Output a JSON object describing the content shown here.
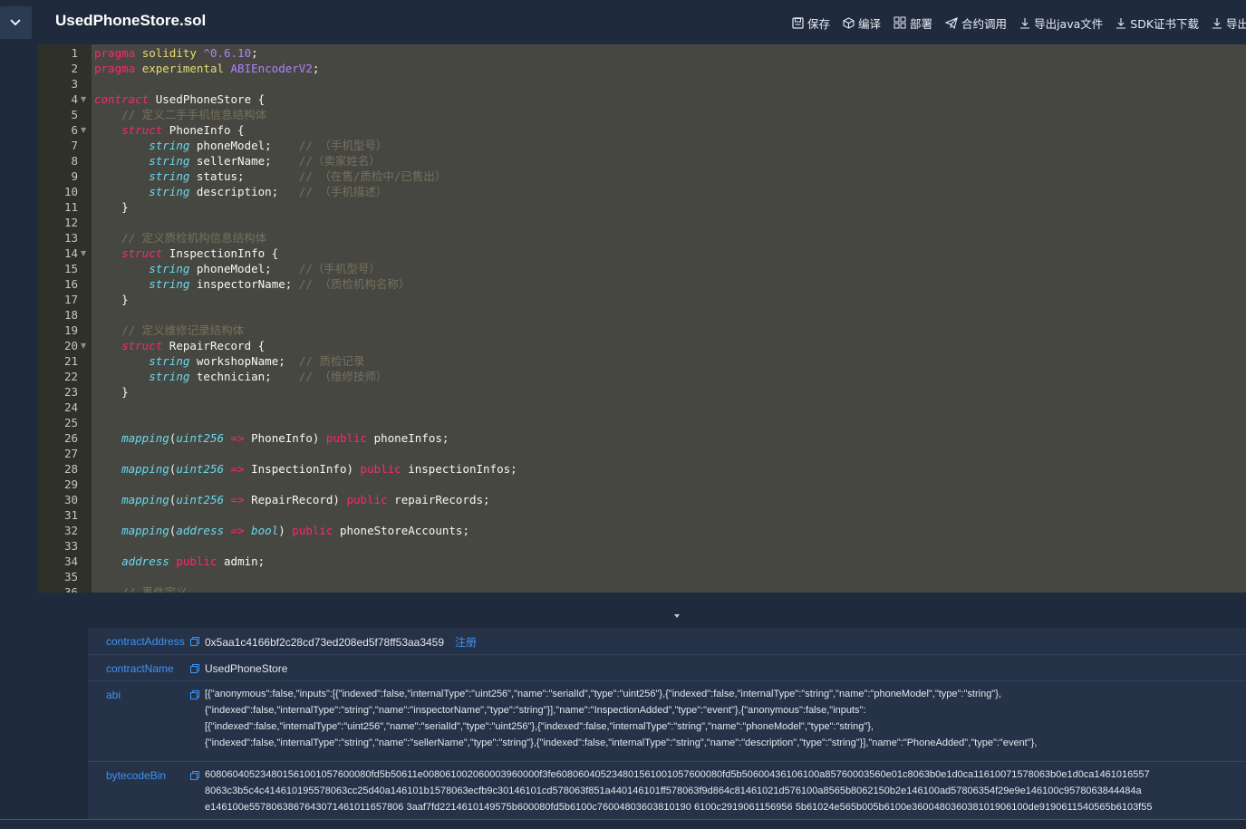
{
  "header": {
    "file_title": "UsedPhoneStore.sol",
    "toolbar": [
      "保存",
      "编译",
      "部署",
      "合约调用",
      "导出java文件",
      "SDK证书下载",
      "导出"
    ]
  },
  "editor": {
    "lines": [
      [
        [
          "kw",
          "pragma "
        ],
        [
          "ac",
          "solidity "
        ],
        [
          "ver",
          "^0.6.10"
        ],
        [
          "pl",
          ";"
        ]
      ],
      [
        [
          "kw",
          "pragma "
        ],
        [
          "ac",
          "experimental "
        ],
        [
          "ver",
          "ABIEncoderV2"
        ],
        [
          "pl",
          ";"
        ]
      ],
      [],
      [
        [
          "kwi",
          "contract "
        ],
        [
          "pl",
          "UsedPhoneStore {"
        ]
      ],
      [
        [
          "pl",
          "    "
        ],
        [
          "cm",
          "// 定义二手手机信息结构体"
        ]
      ],
      [
        [
          "pl",
          "    "
        ],
        [
          "kwi",
          "struct "
        ],
        [
          "pl",
          "PhoneInfo {"
        ]
      ],
      [
        [
          "pl",
          "        "
        ],
        [
          "ty",
          "string "
        ],
        [
          "pl",
          "phoneModel;    "
        ],
        [
          "cm",
          "// （手机型号）"
        ]
      ],
      [
        [
          "pl",
          "        "
        ],
        [
          "ty",
          "string "
        ],
        [
          "pl",
          "sellerName;    "
        ],
        [
          "cm",
          "//（卖家姓名）"
        ]
      ],
      [
        [
          "pl",
          "        "
        ],
        [
          "ty",
          "string "
        ],
        [
          "pl",
          "status;        "
        ],
        [
          "cm",
          "// （在售/质检中/已售出）"
        ]
      ],
      [
        [
          "pl",
          "        "
        ],
        [
          "ty",
          "string "
        ],
        [
          "pl",
          "description;   "
        ],
        [
          "cm",
          "// （手机描述）"
        ]
      ],
      [
        [
          "pl",
          "    }"
        ]
      ],
      [],
      [
        [
          "pl",
          "    "
        ],
        [
          "cm",
          "// 定义质检机构信息结构体"
        ]
      ],
      [
        [
          "pl",
          "    "
        ],
        [
          "kwi",
          "struct "
        ],
        [
          "pl",
          "InspectionInfo {"
        ]
      ],
      [
        [
          "pl",
          "        "
        ],
        [
          "ty",
          "string "
        ],
        [
          "pl",
          "phoneModel;    "
        ],
        [
          "cm",
          "//（手机型号）"
        ]
      ],
      [
        [
          "pl",
          "        "
        ],
        [
          "ty",
          "string "
        ],
        [
          "pl",
          "inspectorName; "
        ],
        [
          "cm",
          "// （质检机构名称）"
        ]
      ],
      [
        [
          "pl",
          "    }"
        ]
      ],
      [],
      [
        [
          "pl",
          "    "
        ],
        [
          "cm",
          "// 定义维修记录结构体"
        ]
      ],
      [
        [
          "pl",
          "    "
        ],
        [
          "kwi",
          "struct "
        ],
        [
          "pl",
          "RepairRecord {"
        ]
      ],
      [
        [
          "pl",
          "        "
        ],
        [
          "ty",
          "string "
        ],
        [
          "pl",
          "workshopName;  "
        ],
        [
          "cm",
          "// 质检记录"
        ]
      ],
      [
        [
          "pl",
          "        "
        ],
        [
          "ty",
          "string "
        ],
        [
          "pl",
          "technician;    "
        ],
        [
          "cm",
          "// （维修技师）"
        ]
      ],
      [
        [
          "pl",
          "    }"
        ]
      ],
      [],
      [],
      [
        [
          "pl",
          "    "
        ],
        [
          "ty",
          "mapping"
        ],
        [
          "pl",
          "("
        ],
        [
          "ty",
          "uint256 "
        ],
        [
          "kw",
          "=> "
        ],
        [
          "pl",
          "PhoneInfo) "
        ],
        [
          "kw",
          "public "
        ],
        [
          "pl",
          "phoneInfos;"
        ]
      ],
      [],
      [
        [
          "pl",
          "    "
        ],
        [
          "ty",
          "mapping"
        ],
        [
          "pl",
          "("
        ],
        [
          "ty",
          "uint256 "
        ],
        [
          "kw",
          "=> "
        ],
        [
          "pl",
          "InspectionInfo) "
        ],
        [
          "kw",
          "public "
        ],
        [
          "pl",
          "inspectionInfos;"
        ]
      ],
      [],
      [
        [
          "pl",
          "    "
        ],
        [
          "ty",
          "mapping"
        ],
        [
          "pl",
          "("
        ],
        [
          "ty",
          "uint256 "
        ],
        [
          "kw",
          "=> "
        ],
        [
          "pl",
          "RepairRecord) "
        ],
        [
          "kw",
          "public "
        ],
        [
          "pl",
          "repairRecords;"
        ]
      ],
      [],
      [
        [
          "pl",
          "    "
        ],
        [
          "ty",
          "mapping"
        ],
        [
          "pl",
          "("
        ],
        [
          "ty",
          "address "
        ],
        [
          "kw",
          "=> "
        ],
        [
          "ty",
          "bool"
        ],
        [
          "pl",
          ") "
        ],
        [
          "kw",
          "public "
        ],
        [
          "pl",
          "phoneStoreAccounts;"
        ]
      ],
      [],
      [
        [
          "pl",
          "    "
        ],
        [
          "ty",
          "address "
        ],
        [
          "kw",
          "public "
        ],
        [
          "pl",
          "admin;"
        ]
      ],
      [],
      [
        [
          "pl",
          "    "
        ],
        [
          "cm",
          "// 事件定义"
        ]
      ]
    ],
    "fold_lines": [
      4,
      6,
      14,
      20
    ]
  },
  "details": {
    "contract_address": {
      "key": "contractAddress",
      "value": "0x5aa1c4166bf2c28cd73ed208ed5f78ff53aa3459",
      "register_label": "注册"
    },
    "contract_name": {
      "key": "contractName",
      "value": "UsedPhoneStore"
    },
    "abi": {
      "key": "abi",
      "lines": [
        "[{\"anonymous\":false,\"inputs\":[{\"indexed\":false,\"internalType\":\"uint256\",\"name\":\"serialId\",\"type\":\"uint256\"},{\"indexed\":false,\"internalType\":\"string\",\"name\":\"phoneModel\",\"type\":\"string\"},",
        "{\"indexed\":false,\"internalType\":\"string\",\"name\":\"inspectorName\",\"type\":\"string\"}],\"name\":\"InspectionAdded\",\"type\":\"event\"},{\"anonymous\":false,\"inputs\":",
        "[{\"indexed\":false,\"internalType\":\"uint256\",\"name\":\"serialId\",\"type\":\"uint256\"},{\"indexed\":false,\"internalType\":\"string\",\"name\":\"phoneModel\",\"type\":\"string\"},",
        "{\"indexed\":false,\"internalType\":\"string\",\"name\":\"sellerName\",\"type\":\"string\"},{\"indexed\":false,\"internalType\":\"string\",\"name\":\"description\",\"type\":\"string\"}],\"name\":\"PhoneAdded\",\"type\":\"event\"},"
      ]
    },
    "bytecode": {
      "key": "bytecodeBin",
      "lines": [
        "608060405234801561001057600080fd5b50611e008061002060003960000f3fe608060405234801561001057600080fd5b50600436106100a85760003560e01c8063b0e1d0ca11610071578063b0e1d0ca1461016557",
        "8063c3b5c4c414610195578063cc25d40a146101b1578063ecfb9c30146101cd578063f851a440146101ff578063f9d864c81461021d576100a8565b8062150b2e146100ad57806354f29e9e146100c9578063844484a",
        "e146100e5578063867643071461011657806 3aaf7fd2214610149575b600080fd5b6100c76004803603810190 6100c2919061156956 5b61024e565b005b6100e360048036038101906100de9190611540565b6103f55"
      ]
    }
  }
}
